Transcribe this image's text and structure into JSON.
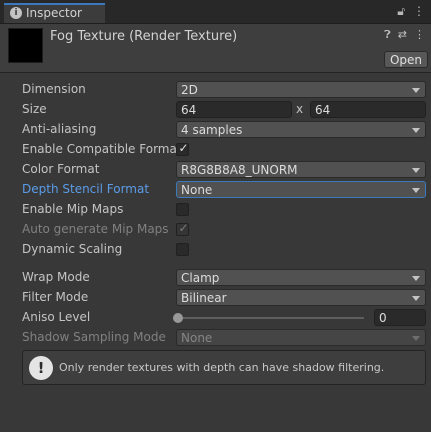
{
  "tab": {
    "icon": "info-icon",
    "label": "Inspector",
    "icons": [
      "lock-icon",
      "more-vert-icon"
    ]
  },
  "header": {
    "title": "Fog Texture (Render Texture)",
    "icons": [
      "help-icon",
      "preset-icon",
      "more-vert-icon"
    ],
    "open_label": "Open"
  },
  "fields": {
    "dimension": {
      "label": "Dimension",
      "value": "2D"
    },
    "size": {
      "label": "Size",
      "width": "64",
      "sep": "x",
      "height": "64"
    },
    "anti_aliasing": {
      "label": "Anti-aliasing",
      "value": "4 samples"
    },
    "enable_compatible_format": {
      "label": "Enable Compatible Format",
      "checked": true,
      "mark": "✓"
    },
    "color_format": {
      "label": "Color Format",
      "value": "R8G8B8A8_UNORM"
    },
    "depth_stencil_format": {
      "label": "Depth Stencil Format",
      "value": "None"
    },
    "enable_mip_maps": {
      "label": "Enable Mip Maps",
      "checked": false
    },
    "auto_generate_mip_maps": {
      "label": "Auto generate Mip Maps",
      "checked": true,
      "mark": "✓",
      "disabled": true
    },
    "dynamic_scaling": {
      "label": "Dynamic Scaling",
      "checked": false
    },
    "wrap_mode": {
      "label": "Wrap Mode",
      "value": "Clamp"
    },
    "filter_mode": {
      "label": "Filter Mode",
      "value": "Bilinear"
    },
    "aniso_level": {
      "label": "Aniso Level",
      "value": "0",
      "slider_fraction": 0
    },
    "shadow_sampling_mode": {
      "label": "Shadow Sampling Mode",
      "value": "None",
      "disabled": true
    }
  },
  "help": {
    "icon": "exclamation-icon",
    "text": "Only render textures with depth can have shadow filtering."
  },
  "colors": {
    "accent": "#3a79bb",
    "highlight_label": "#5b9ce8",
    "background": "#383838"
  }
}
